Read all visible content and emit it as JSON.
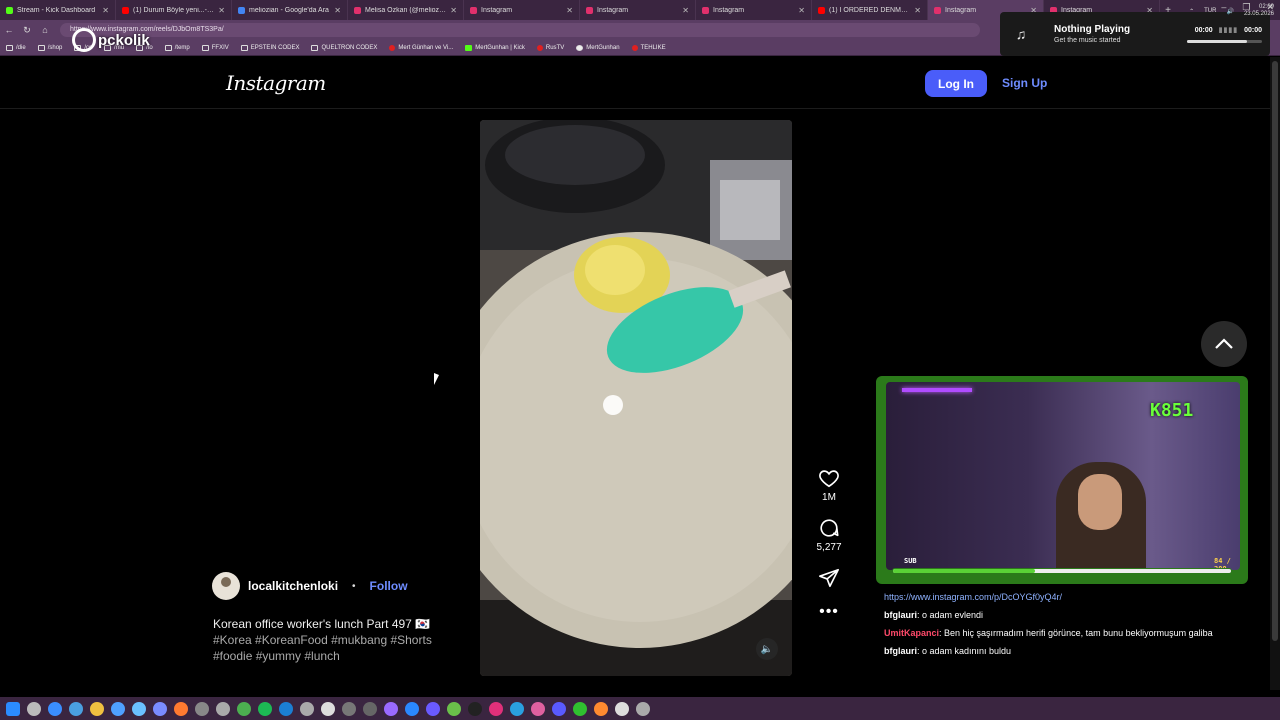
{
  "browser": {
    "tabs": [
      {
        "title": "Stream - Kick Dashboard",
        "color": "#53fc18",
        "active": false
      },
      {
        "title": "(1) Durum Böyle yeni...- YouTube",
        "color": "#ff0000",
        "active": false
      },
      {
        "title": "meliozian - Google'da Ara",
        "color": "#4285f4",
        "active": false
      },
      {
        "title": "Melisa Özkan (@meliozkane) • In",
        "color": "#e1306c",
        "active": false
      },
      {
        "title": "Instagram",
        "color": "#e1306c",
        "active": false
      },
      {
        "title": "Instagram",
        "color": "#e1306c",
        "active": false
      },
      {
        "title": "Instagram",
        "color": "#e1306c",
        "active": false
      },
      {
        "title": "(1) I ORDERED DENMARK'S UNI",
        "color": "#ff0000",
        "active": false
      },
      {
        "title": "Instagram",
        "color": "#e1306c",
        "active": true
      },
      {
        "title": "Instagram",
        "color": "#e1306c",
        "active": false
      }
    ],
    "url": "https://www.instagram.com/reels/DJbOm8TS3Pa/",
    "bookmarks": [
      {
        "label": "/die",
        "kind": "folder"
      },
      {
        "label": "/shop",
        "kind": "folder"
      },
      {
        "label": "/cs",
        "kind": "folder"
      },
      {
        "label": "/mu",
        "kind": "folder"
      },
      {
        "label": "/to",
        "kind": "folder"
      },
      {
        "label": "/temp",
        "kind": "folder"
      },
      {
        "label": "FFXIV",
        "kind": "folder"
      },
      {
        "label": "EPSTEIN CODEX",
        "kind": "folder"
      },
      {
        "label": "QUELTRON CODEX",
        "kind": "folder"
      },
      {
        "label": "Mert Günhan ve Vi...",
        "kind": "red"
      },
      {
        "label": "MertGunhan | Kick",
        "kind": "green"
      },
      {
        "label": "RusTV",
        "kind": "red"
      },
      {
        "label": "MertGunhan",
        "kind": "gh"
      },
      {
        "label": "TEHLIKE",
        "kind": "red"
      }
    ]
  },
  "watermark": {
    "text": "pckolik"
  },
  "music_widget": {
    "title": "Nothing Playing",
    "subtitle": "Get the music started",
    "time_start": "00:00",
    "time_end": "00:00"
  },
  "instagram": {
    "logo": "Instagram",
    "login_label": "Log In",
    "signup_label": "Sign Up",
    "post": {
      "username": "localkitchenloki",
      "separator": "•",
      "follow_label": "Follow",
      "caption": "Korean office worker's lunch Part 497 🇰🇷",
      "hashtags": "#Korea #KoreanFood #mukbang #Shorts #foodie #yummy #lunch",
      "likes": "1M",
      "comments": "5,277"
    }
  },
  "stream_overlay": {
    "sub_counter": "K851",
    "sub_label": "SUB",
    "sub_goal": "84 / 200",
    "sub_progress": 0.42
  },
  "chat": {
    "link": "https://www.instagram.com/p/DcOYGf0yQ4r/",
    "messages": [
      {
        "user": "bfglauri",
        "color": "#ffffff",
        "text": ": o adam evlendi"
      },
      {
        "user": "UmitKapanci",
        "color": "#ff4a6a",
        "text": ": Ben hiç şaşırmadım herifi görünce, tam bunu bekliyormuşum galiba"
      },
      {
        "user": "bfglauri",
        "color": "#ffffff",
        "text": ": o adam kadınını buldu"
      }
    ]
  },
  "taskbar": {
    "icon_colors": [
      "#2b8cff",
      "#bbb",
      "#3a8eff",
      "#4aa0e0",
      "#f0c040",
      "#4fa0ff",
      "#6ac0ff",
      "#7a8cff",
      "#ff7a30",
      "#888",
      "#aaa",
      "#4caf50",
      "#1db954",
      "#1b7fd4",
      "#aaa",
      "#ddd",
      "#777",
      "#666",
      "#9a6aff",
      "#2a88ff",
      "#6a5aff",
      "#6ac04a",
      "#222",
      "#e0307a",
      "#2aa0e0",
      "#e060a0",
      "#5a5aff",
      "#30c030",
      "#ff8a30",
      "#ddd",
      "#aaa"
    ],
    "lang": "TUR",
    "time": "02:09",
    "date": "23.05.2026"
  }
}
